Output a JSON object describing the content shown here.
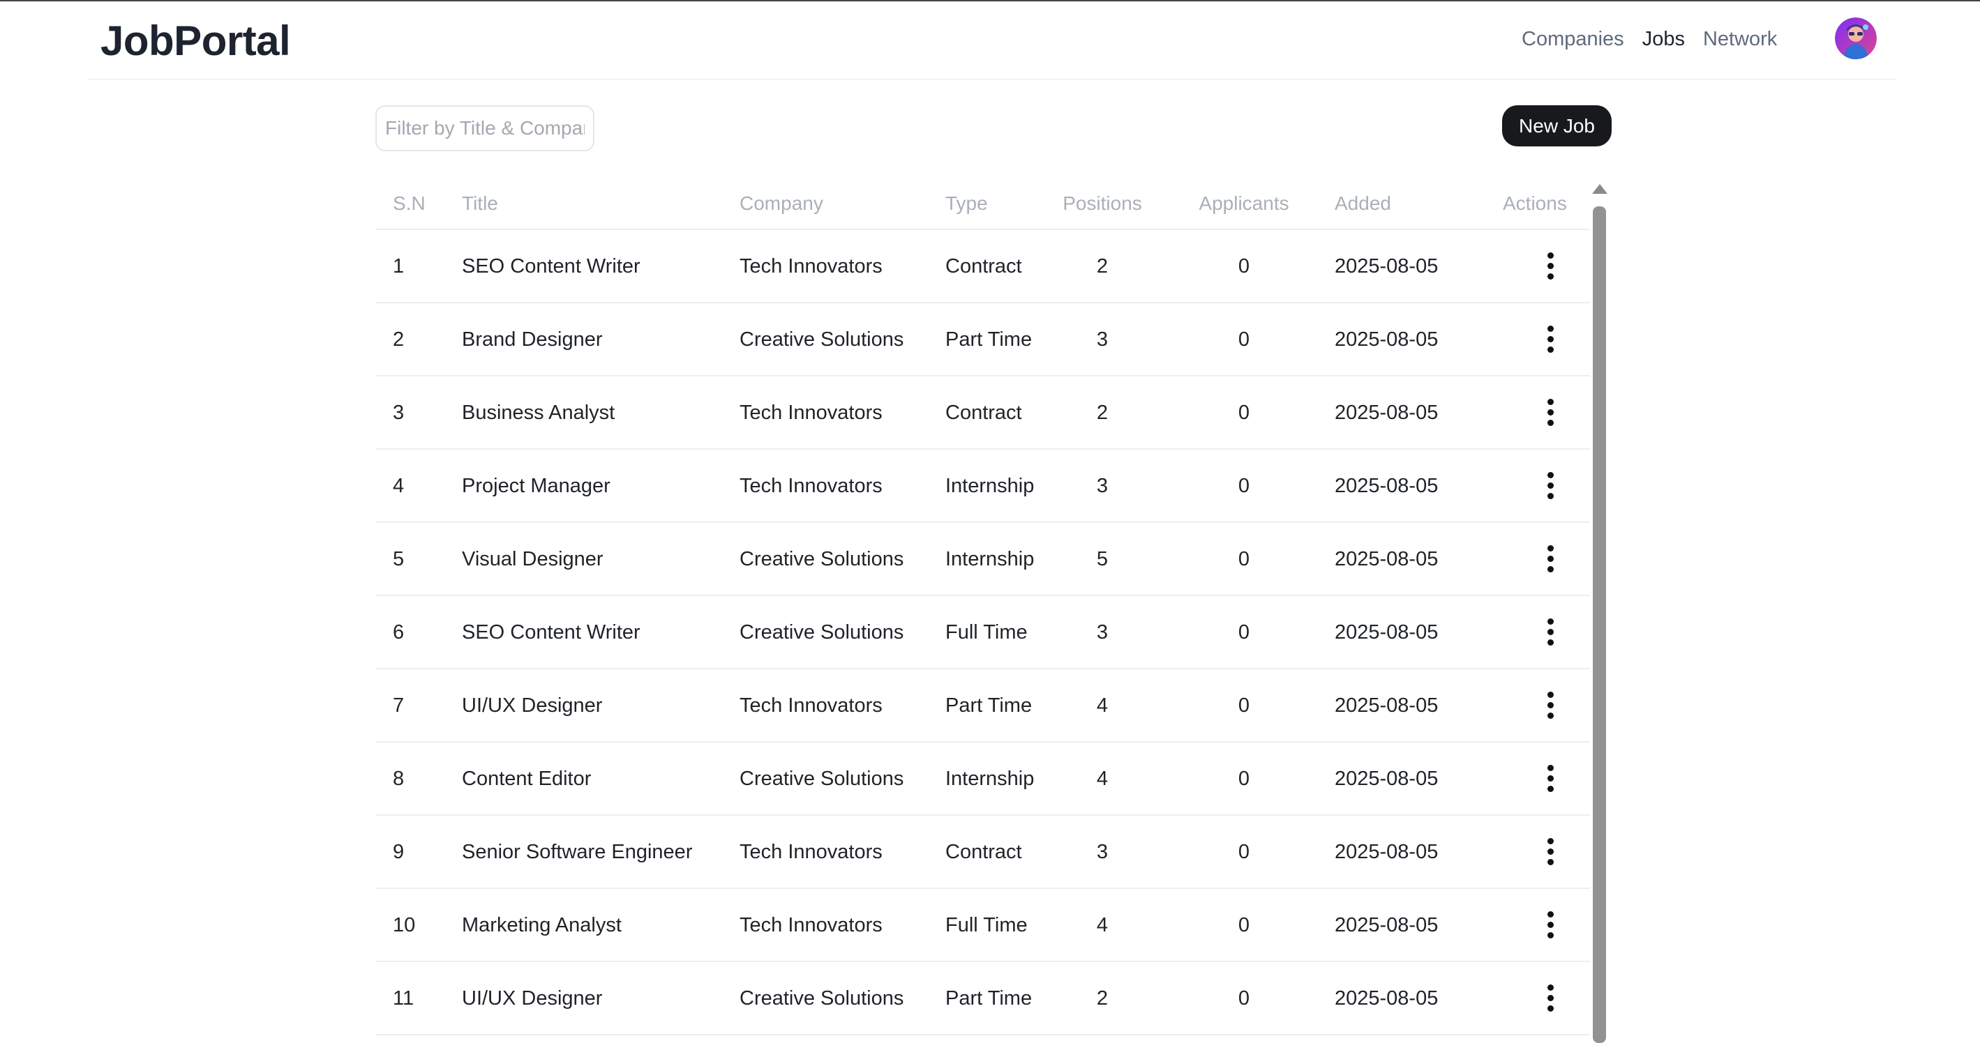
{
  "header": {
    "brand": "JobPortal",
    "nav": [
      {
        "label": "Companies",
        "active": false
      },
      {
        "label": "Jobs",
        "active": true
      },
      {
        "label": "Network",
        "active": false
      }
    ],
    "avatar_icon": "user-avatar"
  },
  "toolbar": {
    "filter_placeholder": "Filter by Title & Company",
    "new_job_label": "New Job"
  },
  "table": {
    "columns": [
      "S.N",
      "Title",
      "Company",
      "Type",
      "Positions",
      "Applicants",
      "Added",
      "Actions"
    ],
    "rows": [
      {
        "sn": "1",
        "title": "SEO Content Writer",
        "company": "Tech Innovators",
        "type": "Contract",
        "positions": "2",
        "applicants": "0",
        "added": "2025-08-05"
      },
      {
        "sn": "2",
        "title": "Brand Designer",
        "company": "Creative Solutions",
        "type": "Part Time",
        "positions": "3",
        "applicants": "0",
        "added": "2025-08-05"
      },
      {
        "sn": "3",
        "title": "Business Analyst",
        "company": "Tech Innovators",
        "type": "Contract",
        "positions": "2",
        "applicants": "0",
        "added": "2025-08-05"
      },
      {
        "sn": "4",
        "title": "Project Manager",
        "company": "Tech Innovators",
        "type": "Internship",
        "positions": "3",
        "applicants": "0",
        "added": "2025-08-05"
      },
      {
        "sn": "5",
        "title": "Visual Designer",
        "company": "Creative Solutions",
        "type": "Internship",
        "positions": "5",
        "applicants": "0",
        "added": "2025-08-05"
      },
      {
        "sn": "6",
        "title": "SEO Content Writer",
        "company": "Creative Solutions",
        "type": "Full Time",
        "positions": "3",
        "applicants": "0",
        "added": "2025-08-05"
      },
      {
        "sn": "7",
        "title": "UI/UX Designer",
        "company": "Tech Innovators",
        "type": "Part Time",
        "positions": "4",
        "applicants": "0",
        "added": "2025-08-05"
      },
      {
        "sn": "8",
        "title": "Content Editor",
        "company": "Creative Solutions",
        "type": "Internship",
        "positions": "4",
        "applicants": "0",
        "added": "2025-08-05"
      },
      {
        "sn": "9",
        "title": "Senior Software Engineer",
        "company": "Tech Innovators",
        "type": "Contract",
        "positions": "3",
        "applicants": "0",
        "added": "2025-08-05"
      },
      {
        "sn": "10",
        "title": "Marketing Analyst",
        "company": "Tech Innovators",
        "type": "Full Time",
        "positions": "4",
        "applicants": "0",
        "added": "2025-08-05"
      },
      {
        "sn": "11",
        "title": "UI/UX Designer",
        "company": "Creative Solutions",
        "type": "Part Time",
        "positions": "2",
        "applicants": "0",
        "added": "2025-08-05"
      }
    ],
    "row_action_icon": "more-vertical-icon"
  },
  "colors": {
    "brand_text": "#1d2430",
    "primary_button": "#17191c",
    "header_text_muted": "#aab0b8",
    "scrollbar": "#929292"
  }
}
